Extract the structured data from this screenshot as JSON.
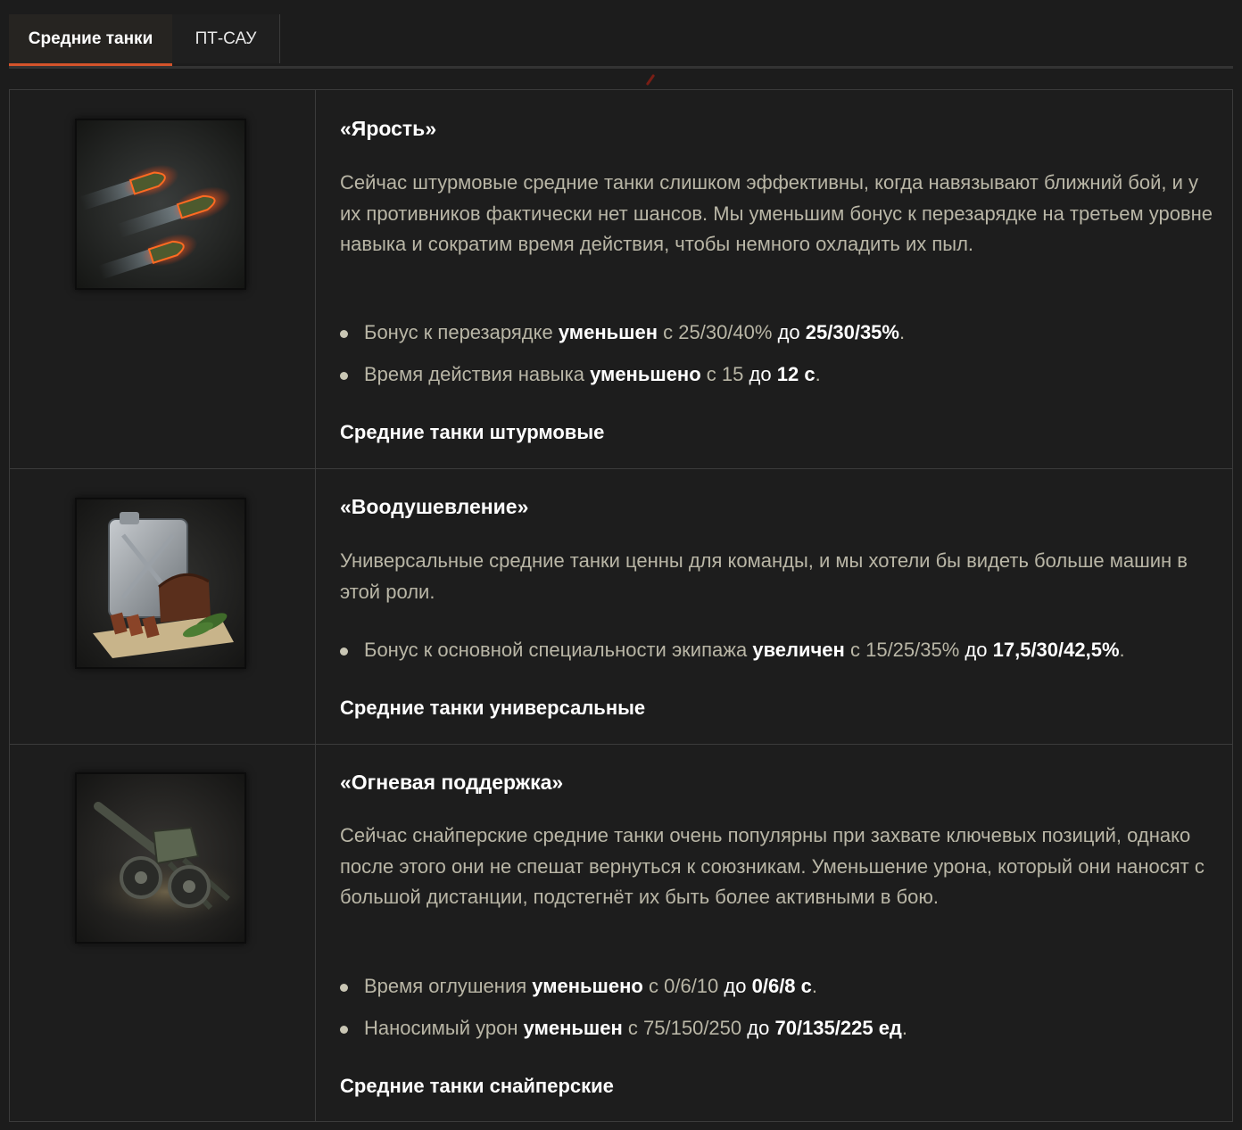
{
  "tabs": [
    {
      "label": "Средние танки",
      "active": true
    },
    {
      "label": "ПТ-САУ",
      "active": false
    }
  ],
  "colors": {
    "accent": "#d4532b",
    "text_muted": "#b9b6a6",
    "text_bright": "#ffffff",
    "background": "#1c1c1c"
  },
  "skills": [
    {
      "icon": "shells-icon",
      "title": "«Ярость»",
      "description": "Сейчас штурмовые средние танки слишком эффективны, когда навязывают ближний бой, и у их противников фактически нет шансов. Мы уменьшим бонус к перезарядке на третьем уровне навыка и сократим время действия, чтобы немного охладить их пыл.",
      "bullets": [
        {
          "text": "Бонус к перезарядке",
          "verb": "уменьшен",
          "from_prefix": "с",
          "from": "25/30/40%",
          "to_prefix": "до",
          "to": "25/30/35%",
          "end": "."
        },
        {
          "text": "Время действия навыка",
          "verb": "уменьшено",
          "from_prefix": "с",
          "from": "15",
          "to_prefix": "до",
          "to": "12 с",
          "end": "."
        }
      ],
      "role": "Средние танки штурмовые"
    },
    {
      "icon": "jerrycan-bread-icon",
      "title": "«Воодушевление»",
      "description": "Универсальные средние танки ценны для команды, и мы хотели бы видеть больше машин в этой роли.",
      "bullets": [
        {
          "text": "Бонус к основной специальности экипажа",
          "verb": "увеличен",
          "from_prefix": "с",
          "from": "15/25/35%",
          "to_prefix": "до",
          "to": "17,5/30/42,5%",
          "end": "."
        }
      ],
      "role": "Средние танки универсальные"
    },
    {
      "icon": "howitzer-icon",
      "title": "«Огневая поддержка»",
      "description": "Сейчас снайперские средние танки очень популярны при захвате ключевых позиций, однако после этого они не спешат вернуться к союзникам. Уменьшение урона, который они наносят с большой дистанции, подстегнёт их быть более активными в бою.",
      "bullets": [
        {
          "text": "Время оглушения",
          "verb": "уменьшено",
          "from_prefix": "с",
          "from": "0/6/10",
          "to_prefix": "до",
          "to": "0/6/8 с",
          "end": "."
        },
        {
          "text": "Наносимый урон",
          "verb": "уменьшен",
          "from_prefix": "с",
          "from": "75/150/250",
          "to_prefix": "до",
          "to": "70/135/225 ед",
          "end": "."
        }
      ],
      "role": "Средние танки снайперские"
    }
  ]
}
